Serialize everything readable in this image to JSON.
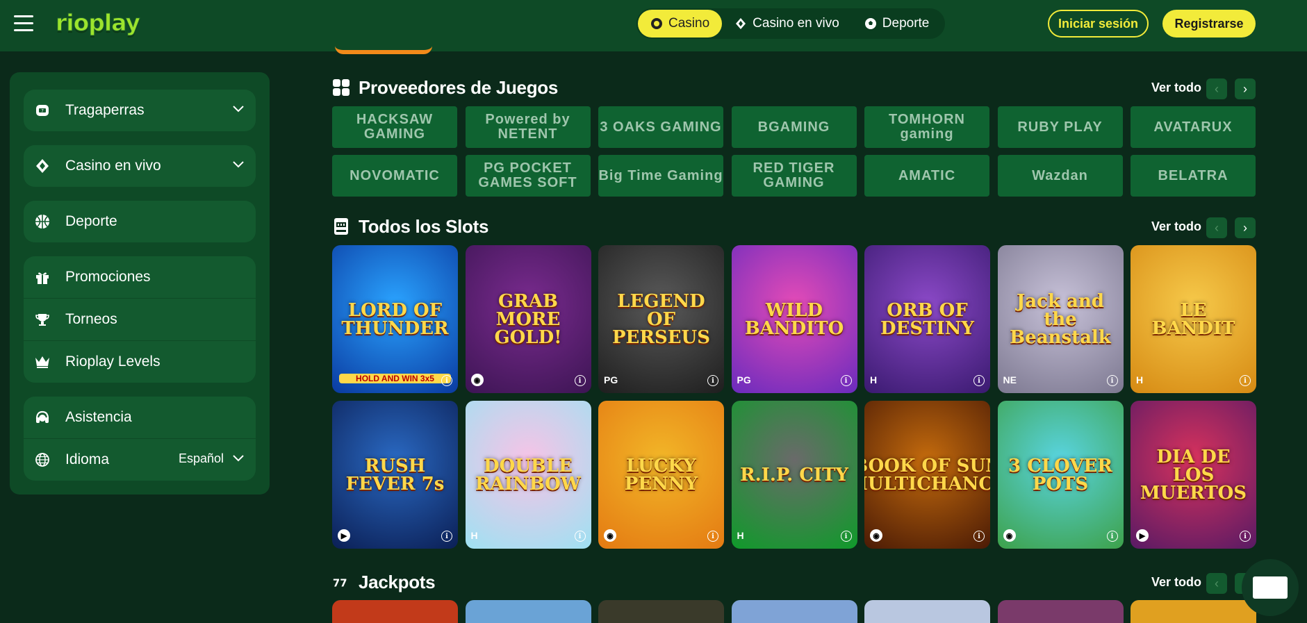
{
  "header": {
    "logo_text": "rioplay",
    "nav_tabs": [
      {
        "label": "Casino",
        "icon": "casino-chip-icon",
        "active": true
      },
      {
        "label": "Casino en vivo",
        "icon": "diamond-card-icon",
        "active": false
      },
      {
        "label": "Deporte",
        "icon": "soccer-ball-icon",
        "active": false
      }
    ],
    "login_label": "Iniciar sesión",
    "register_label": "Registrarse"
  },
  "sidebar": {
    "items": [
      {
        "label": "Tragaperras",
        "icon": "slot-machine-icon",
        "expandable": true
      },
      {
        "label": "Casino en vivo",
        "icon": "diamond-card-icon",
        "expandable": true
      },
      {
        "label": "Deporte",
        "icon": "basketball-icon",
        "expandable": false
      },
      {
        "label": "Promociones",
        "icon": "gift-icon"
      },
      {
        "label": "Torneos",
        "icon": "trophy-icon"
      },
      {
        "label": "Rioplay Levels",
        "icon": "crown-icon"
      },
      {
        "label": "Asistencia",
        "icon": "headset-icon"
      },
      {
        "label": "Idioma",
        "icon": "globe-icon",
        "value": "Español"
      }
    ]
  },
  "sections": {
    "providers": {
      "title": "Proveedores de Juegos",
      "see_all": "Ver todo",
      "items": [
        "HACKSAW GAMING",
        "Powered by NETENT",
        "3 OAKS GAMING",
        "BGAMING",
        "TOMHORN gaming",
        "RUBY PLAY",
        "AVATARUX",
        "NOVOMATIC",
        "PG POCKET GAMES SOFT",
        "Big Time Gaming",
        "RED TIGER GAMING",
        "AMATIC",
        "Wazdan",
        "BELATRA"
      ]
    },
    "slots": {
      "title": "Todos los Slots",
      "see_all": "Ver todo",
      "games": [
        {
          "name": "LORD OF THUNDER",
          "sub": "HOLD AND WIN 3x5",
          "provider_badge": "",
          "color_a": "#2aa3ff",
          "color_b": "#0a3aa0"
        },
        {
          "name": "GRAB MORE GOLD!",
          "provider_badge": "◉",
          "color_a": "#7a2b8f",
          "color_b": "#3d1554"
        },
        {
          "name": "LEGEND OF PERSEUS",
          "provider_badge": "PG",
          "color_a": "#5a5a5a",
          "color_b": "#1e1e1e"
        },
        {
          "name": "WILD BANDITO",
          "provider_badge": "PG",
          "color_a": "#e44bb7",
          "color_b": "#6a2bbd"
        },
        {
          "name": "ORB OF DESTINY",
          "provider_badge": "H",
          "color_a": "#8b49c7",
          "color_b": "#3a1a70"
        },
        {
          "name": "Jack and the Beanstalk",
          "provider_badge": "NE",
          "color_a": "#c8c2d9",
          "color_b": "#7c7890"
        },
        {
          "name": "LE BANDIT",
          "provider_badge": "H",
          "color_a": "#f6c94a",
          "color_b": "#d68a13"
        },
        {
          "name": "RUSH FEVER 7s",
          "provider_badge": "▶",
          "color_a": "#2a69c2",
          "color_b": "#0b1f55"
        },
        {
          "name": "DOUBLE RAINBOW",
          "provider_badge": "H",
          "color_a": "#f7c3e6",
          "color_b": "#9ee1f2"
        },
        {
          "name": "LUCKY PENNY",
          "provider_badge": "◉",
          "color_a": "#f2b628",
          "color_b": "#e47a12"
        },
        {
          "name": "R.I.P. CITY",
          "provider_badge": "H",
          "color_a": "#6a6a6a",
          "color_b": "#0f9a2a"
        },
        {
          "name": "BOOK OF SUN MULTICHANCE",
          "provider_badge": "◉",
          "color_a": "#c46b0d",
          "color_b": "#4a1a05"
        },
        {
          "name": "3 CLOVER POTS",
          "provider_badge": "◉",
          "color_a": "#59d4e0",
          "color_b": "#3da14a"
        },
        {
          "name": "DIA DE LOS MUERTOS",
          "provider_badge": "▶",
          "color_a": "#d8325d",
          "color_b": "#581a64"
        }
      ]
    },
    "jackpots": {
      "title": "Jackpots",
      "see_all": "Ver todo",
      "colors": [
        "#c23a1a",
        "#6aa3d6",
        "#3a3a2a",
        "#7fa3d6",
        "#b9c7e0",
        "#7a3a6a",
        "#e0a020"
      ]
    }
  }
}
